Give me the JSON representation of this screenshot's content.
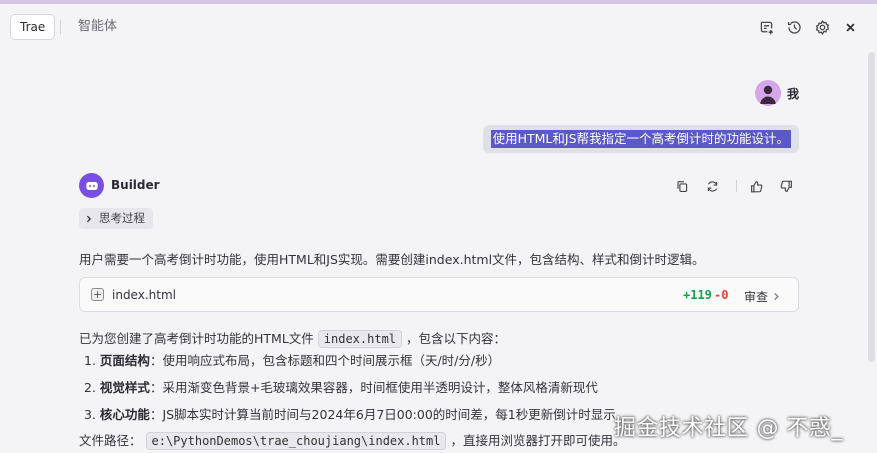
{
  "header": {
    "tab_trae": "Trae",
    "tab_agent": "智能体"
  },
  "icons": {
    "new_chat": "new-chat-icon",
    "history": "history-icon",
    "settings": "gear-icon",
    "close": "close-icon",
    "copy": "copy-icon",
    "retry": "retry-icon",
    "thumbs_up": "thumbs-up-icon",
    "thumbs_down": "thumbs-down-icon"
  },
  "user": {
    "name": "我",
    "message": "使用HTML和JS帮我指定一个高考倒计时的功能设计。"
  },
  "bot": {
    "name": "Builder",
    "thinking_label": "思考过程",
    "intro": "用户需要一个高考倒计时功能，使用HTML和JS实现。需要创建index.html文件，包含结构、样式和倒计时逻辑。",
    "file": {
      "name": "index.html",
      "additions": "+119",
      "deletions": "-0",
      "review_label": "审查"
    },
    "summary_prefix": "已为您创建了高考倒计时功能的HTML文件",
    "summary_code": "index.html",
    "summary_suffix": "，包含以下内容：",
    "list": [
      {
        "num": "1.",
        "title": "页面结构",
        "text": "：使用响应式布局，包含标题和四个时间展示框（天/时/分/秒）"
      },
      {
        "num": "2.",
        "title": "视觉样式",
        "text": "：采用渐变色背景+毛玻璃效果容器，时间框使用半透明设计，整体风格清新现代"
      },
      {
        "num": "3.",
        "title": "核心功能",
        "text": "：JS脚本实时计算当前时间与2024年6月7日00:00的时间差，每1秒更新倒计时显示"
      }
    ],
    "path_label": "文件路径：",
    "path_code": "e:\\PythonDemos\\trae_choujiang\\index.html",
    "path_suffix": "，直接用浏览器打开即可使用。"
  },
  "watermark": "掘金技术社区 @ 不惑_",
  "colors": {
    "accent": "#5b58c8",
    "bot_avatar": "#7a4fe0",
    "user_avatar": "#d7a6e8",
    "additions": "#16a34a",
    "deletions": "#e0453a"
  }
}
